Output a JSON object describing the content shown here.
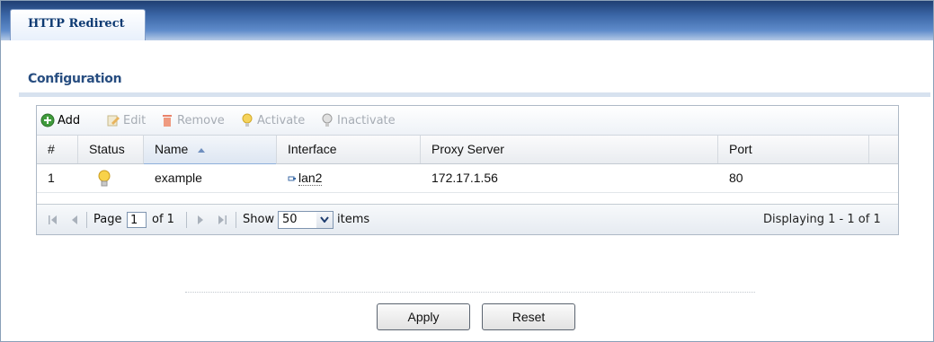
{
  "tabs": [
    {
      "label": "HTTP Redirect",
      "active": true
    }
  ],
  "section": {
    "title": "Configuration"
  },
  "toolbar": {
    "add": "Add",
    "edit": "Edit",
    "remove": "Remove",
    "activate": "Activate",
    "inactivate": "Inactivate"
  },
  "table": {
    "columns": [
      "#",
      "Status",
      "Name",
      "Interface",
      "Proxy Server",
      "Port"
    ],
    "sorted_column": "Name",
    "sort_direction": "ascending",
    "rows": [
      {
        "index": "1",
        "status": "active",
        "name": "example",
        "interface": "lan2",
        "proxy_server": "172.17.1.56",
        "port": "80"
      }
    ]
  },
  "pager": {
    "page_label": "Page",
    "page_value": "1",
    "of_label": "of 1",
    "show_label": "Show",
    "show_value": "50",
    "items_label": "items",
    "displaying": "Displaying 1 - 1 of 1"
  },
  "buttons": {
    "apply": "Apply",
    "reset": "Reset"
  },
  "colors": {
    "tab_bar": "#3a65a5",
    "section_title": "#274d80",
    "sort_indicator": "#8fb0db"
  }
}
